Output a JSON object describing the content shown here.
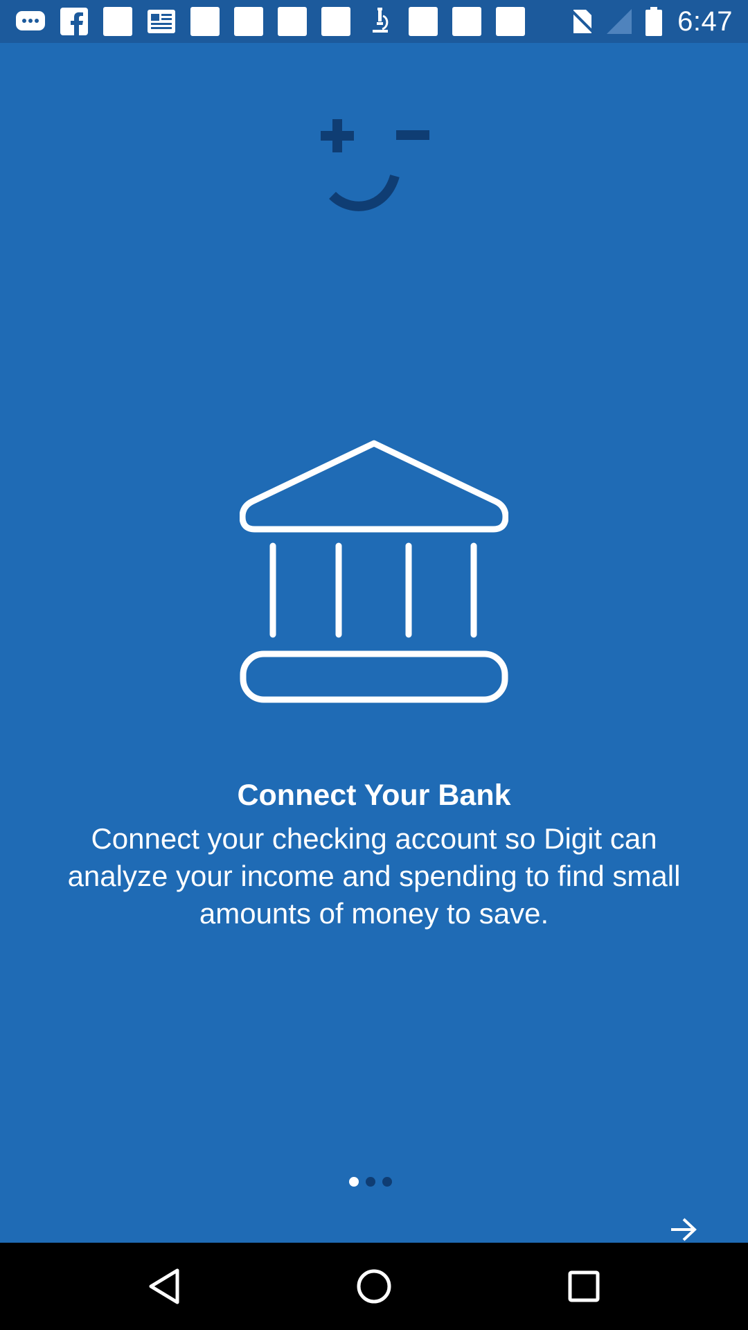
{
  "status_bar": {
    "time": "6:47",
    "notification_icons": [
      "chat-bubble-icon",
      "facebook-icon",
      "blank-app-icon",
      "news-icon",
      "blank-app-icon",
      "blank-app-icon",
      "blank-app-icon",
      "blank-app-icon",
      "microscope-icon",
      "blank-app-icon",
      "blank-app-icon",
      "blank-app-icon"
    ],
    "system_icons": [
      "no-sim-icon",
      "signal-icon",
      "battery-icon"
    ]
  },
  "onboarding": {
    "title": "Connect Your Bank",
    "description": "Connect your checking account so Digit can analyze your income and spending to find small amounts of money to save.",
    "page_indicator": {
      "total": 3,
      "current": 1
    }
  },
  "colors": {
    "background": "#1f6bb5",
    "status_bar": "#1c5a9c",
    "logo": "#0f3d73",
    "text": "#ffffff"
  },
  "nav_bar": {
    "buttons": [
      "back-icon",
      "home-icon",
      "recents-icon"
    ]
  }
}
